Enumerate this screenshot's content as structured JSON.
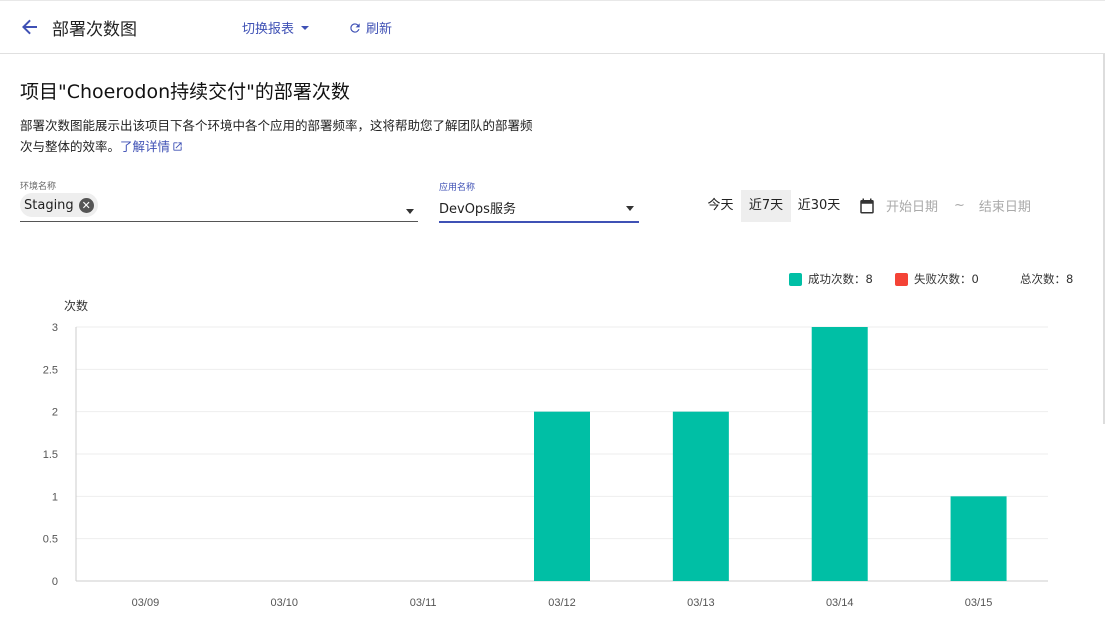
{
  "header": {
    "title": "部署次数图",
    "switch_report_label": "切换报表",
    "refresh_label": "刷新"
  },
  "content": {
    "heading": "项目\"Choerodon持续交付\"的部署次数",
    "description": "部署次数图能展示出该项目下各个环境中各个应用的部署频率，这将帮助您了解团队的部署频次与整体的效率。",
    "learn_more": "了解详情"
  },
  "filters": {
    "env_label": "环境名称",
    "env_value": "Staging",
    "app_label": "应用名称",
    "app_value": "DevOps服务",
    "ranges": [
      "今天",
      "近7天",
      "近30天"
    ],
    "active_range": "近7天",
    "start_placeholder": "开始日期",
    "separator": "~",
    "end_placeholder": "结束日期"
  },
  "legend": {
    "success_label": "成功次数：8",
    "fail_label": "失败次数：0",
    "total_label": "总次数：8"
  },
  "colors": {
    "accent": "#3f51b5",
    "success": "#00bfa5",
    "fail": "#f44336"
  },
  "chart_data": {
    "type": "bar",
    "ylabel": "次数",
    "ylim": [
      0,
      3
    ],
    "yticks": [
      "0",
      "0.5",
      "1",
      "1.5",
      "2",
      "2.5",
      "3"
    ],
    "categories": [
      "03/09",
      "03/10",
      "03/11",
      "03/12",
      "03/13",
      "03/14",
      "03/15"
    ],
    "series": [
      {
        "name": "成功次数",
        "values": [
          0,
          0,
          0,
          2,
          2,
          3,
          1
        ]
      },
      {
        "name": "失败次数",
        "values": [
          0,
          0,
          0,
          0,
          0,
          0,
          0
        ]
      }
    ],
    "grid": true,
    "legend_position": "top-right"
  }
}
